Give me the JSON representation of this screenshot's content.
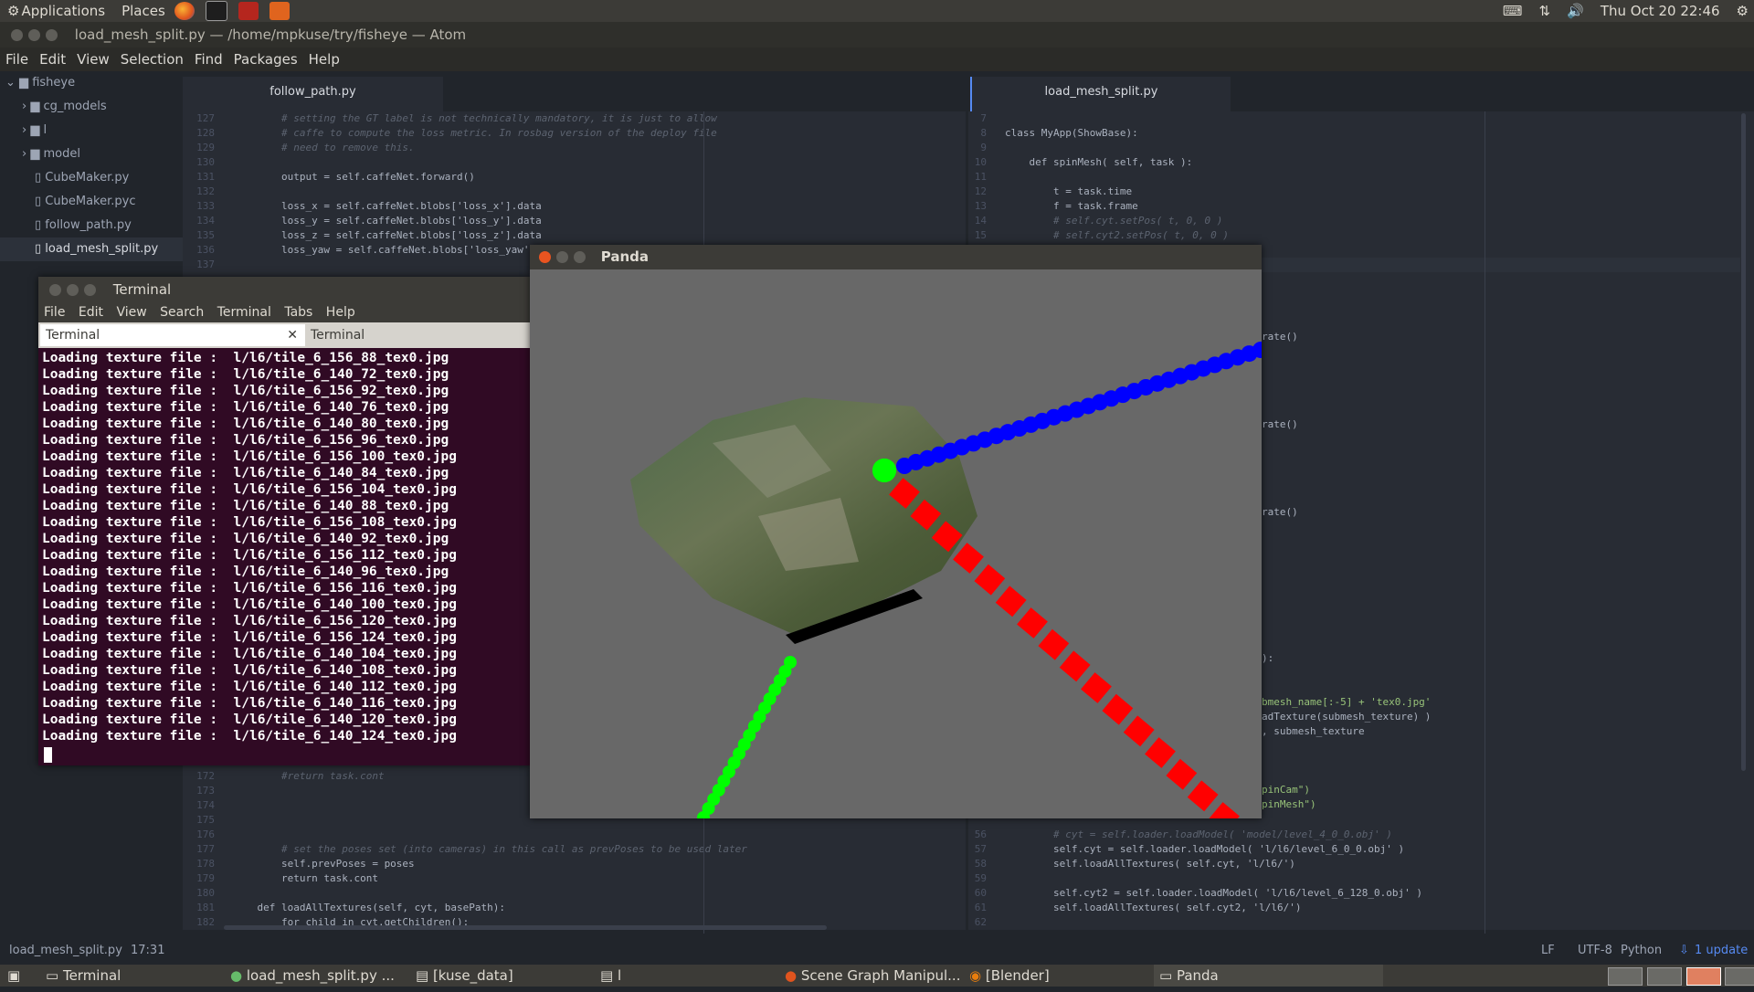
{
  "top_panel": {
    "applications": "Applications",
    "places": "Places",
    "clock": "Thu Oct 20 22:46"
  },
  "atom": {
    "title": "load_mesh_split.py — /home/mpkuse/try/fisheye — Atom",
    "menu": [
      "File",
      "Edit",
      "View",
      "Selection",
      "Find",
      "Packages",
      "Help"
    ],
    "tree": {
      "root": "fisheye",
      "items": [
        {
          "label": "cg_models",
          "type": "folder"
        },
        {
          "label": "l",
          "type": "folder"
        },
        {
          "label": "model",
          "type": "folder"
        },
        {
          "label": "CubeMaker.py",
          "type": "file"
        },
        {
          "label": "CubeMaker.pyc",
          "type": "file"
        },
        {
          "label": "follow_path.py",
          "type": "file"
        },
        {
          "label": "load_mesh_split.py",
          "type": "file"
        }
      ]
    },
    "left_tab": "follow_path.py",
    "right_tab": "load_mesh_split.py",
    "left_code": [
      {
        "n": "127",
        "t": "        # setting the GT label is not technically mandatory, it is just to allow",
        "c": "cm"
      },
      {
        "n": "128",
        "t": "        # caffe to compute the loss metric. In rosbag version of the deploy file",
        "c": "cm"
      },
      {
        "n": "129",
        "t": "        # need to remove this.",
        "c": "cm"
      },
      {
        "n": "130",
        "t": "",
        "c": ""
      },
      {
        "n": "131",
        "t": "        output = self.caffeNet.forward()",
        "c": ""
      },
      {
        "n": "132",
        "t": "",
        "c": ""
      },
      {
        "n": "133",
        "t": "        loss_x = self.caffeNet.blobs['loss_x'].data",
        "c": ""
      },
      {
        "n": "134",
        "t": "        loss_y = self.caffeNet.blobs['loss_y'].data",
        "c": ""
      },
      {
        "n": "135",
        "t": "        loss_z = self.caffeNet.blobs['loss_z'].data",
        "c": ""
      },
      {
        "n": "136",
        "t": "        loss_yaw = self.caffeNet.blobs['loss_yaw'].",
        "c": ""
      },
      {
        "n": "137",
        "t": "",
        "c": ""
      }
    ],
    "left_code_bottom": [
      {
        "n": "172",
        "t": "        #return task.cont",
        "c": "cm"
      },
      {
        "n": "173",
        "t": "",
        "c": ""
      },
      {
        "n": "174",
        "t": "",
        "c": ""
      },
      {
        "n": "175",
        "t": "",
        "c": ""
      },
      {
        "n": "176",
        "t": "",
        "c": ""
      },
      {
        "n": "177",
        "t": "        # set the poses set (into cameras) in this call as prevPoses to be used later",
        "c": "cm"
      },
      {
        "n": "178",
        "t": "        self.prevPoses = poses",
        "c": ""
      },
      {
        "n": "179",
        "t": "        return task.cont",
        "c": ""
      },
      {
        "n": "180",
        "t": "",
        "c": ""
      },
      {
        "n": "181",
        "t": "    def loadAllTextures(self, cyt, basePath):",
        "c": ""
      },
      {
        "n": "182",
        "t": "        for child in cyt.getChildren():",
        "c": ""
      }
    ],
    "right_code": [
      {
        "n": "7",
        "t": "",
        "c": ""
      },
      {
        "n": "8",
        "t": "class MyApp(ShowBase):",
        "c": ""
      },
      {
        "n": "9",
        "t": "",
        "c": ""
      },
      {
        "n": "10",
        "t": "    def spinMesh( self, task ):",
        "c": ""
      },
      {
        "n": "11",
        "t": "",
        "c": ""
      },
      {
        "n": "12",
        "t": "        t = task.time",
        "c": ""
      },
      {
        "n": "13",
        "t": "        f = task.frame",
        "c": ""
      },
      {
        "n": "14",
        "t": "        # self.cyt.setPos( t, 0, 0 )",
        "c": "cm"
      },
      {
        "n": "15",
        "t": "        # self.cyt2.setPos( t, 0, 0 )",
        "c": "cm"
      }
    ],
    "right_fragments": [
      "rate()",
      "rate()",
      "rate()",
      "):",
      "bmesh_name[:-5] + 'tex0.jpg'",
      "adTexture(submesh_texture) )",
      ", submesh_texture",
      "pinCam\")",
      "pinMesh\")"
    ],
    "right_code_bottom": [
      {
        "n": "56",
        "t": "        # cyt = self.loader.loadModel( 'model/level_4_0_0.obj' )",
        "c": "cm"
      },
      {
        "n": "57",
        "t": "        self.cyt = self.loader.loadModel( 'l/l6/level_6_0_0.obj' )",
        "c": ""
      },
      {
        "n": "58",
        "t": "        self.loadAllTextures( self.cyt, 'l/l6/')",
        "c": ""
      },
      {
        "n": "59",
        "t": "",
        "c": ""
      },
      {
        "n": "60",
        "t": "        self.cyt2 = self.loader.loadModel( 'l/l6/level_6_128_0.obj' )",
        "c": ""
      },
      {
        "n": "61",
        "t": "        self.loadAllTextures( self.cyt2, 'l/l6/')",
        "c": ""
      },
      {
        "n": "62",
        "t": "",
        "c": ""
      }
    ],
    "status": {
      "file": "load_mesh_split.py",
      "cursor": "17:31",
      "line_ending": "LF",
      "encoding": "UTF-8",
      "grammar": "Python",
      "updates": "1 update"
    }
  },
  "terminal": {
    "title": "Terminal",
    "menu": [
      "File",
      "Edit",
      "View",
      "Search",
      "Terminal",
      "Tabs",
      "Help"
    ],
    "tabs": [
      "Terminal",
      "Terminal"
    ],
    "lines": [
      "Loading texture file :  l/l6/tile_6_156_88_tex0.jpg",
      "Loading texture file :  l/l6/tile_6_140_72_tex0.jpg",
      "Loading texture file :  l/l6/tile_6_156_92_tex0.jpg",
      "Loading texture file :  l/l6/tile_6_140_76_tex0.jpg",
      "Loading texture file :  l/l6/tile_6_140_80_tex0.jpg",
      "Loading texture file :  l/l6/tile_6_156_96_tex0.jpg",
      "Loading texture file :  l/l6/tile_6_156_100_tex0.jpg",
      "Loading texture file :  l/l6/tile_6_140_84_tex0.jpg",
      "Loading texture file :  l/l6/tile_6_156_104_tex0.jpg",
      "Loading texture file :  l/l6/tile_6_140_88_tex0.jpg",
      "Loading texture file :  l/l6/tile_6_156_108_tex0.jpg",
      "Loading texture file :  l/l6/tile_6_140_92_tex0.jpg",
      "Loading texture file :  l/l6/tile_6_156_112_tex0.jpg",
      "Loading texture file :  l/l6/tile_6_140_96_tex0.jpg",
      "Loading texture file :  l/l6/tile_6_156_116_tex0.jpg",
      "Loading texture file :  l/l6/tile_6_140_100_tex0.jpg",
      "Loading texture file :  l/l6/tile_6_156_120_tex0.jpg",
      "Loading texture file :  l/l6/tile_6_156_124_tex0.jpg",
      "Loading texture file :  l/l6/tile_6_140_104_tex0.jpg",
      "Loading texture file :  l/l6/tile_6_140_108_tex0.jpg",
      "Loading texture file :  l/l6/tile_6_140_112_tex0.jpg",
      "Loading texture file :  l/l6/tile_6_140_116_tex0.jpg",
      "Loading texture file :  l/l6/tile_6_140_120_tex0.jpg",
      "Loading texture file :  l/l6/tile_6_140_124_tex0.jpg"
    ]
  },
  "panda": {
    "title": "Panda",
    "colors": {
      "blue": "#0000ff",
      "red": "#ff0000",
      "green": "#00ff00",
      "background": "#686868"
    }
  },
  "taskbar": {
    "items": [
      "Terminal",
      "load_mesh_split.py ...",
      "[kuse_data]",
      "l",
      "Scene Graph Manipul...",
      "[Blender]",
      "Panda"
    ]
  }
}
